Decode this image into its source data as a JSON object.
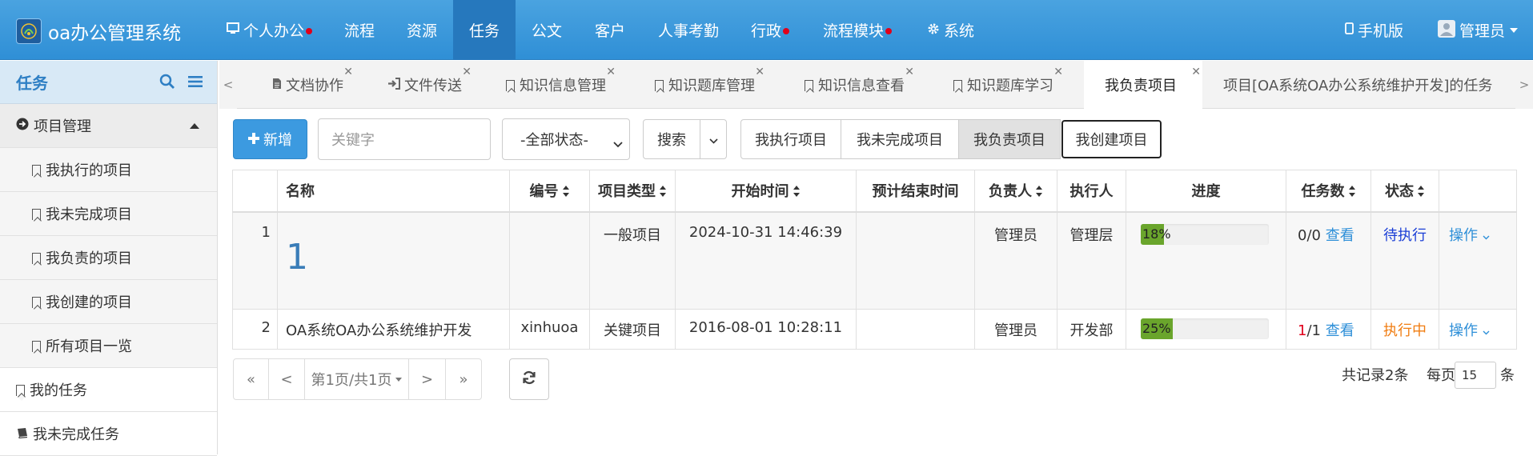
{
  "app": {
    "title": "oa办公管理系统"
  },
  "nav": {
    "items": [
      {
        "label": "个人办公",
        "icon": "monitor-icon",
        "dot": true
      },
      {
        "label": "流程"
      },
      {
        "label": "资源"
      },
      {
        "label": "任务",
        "active": true
      },
      {
        "label": "公文"
      },
      {
        "label": "客户"
      },
      {
        "label": "人事考勤"
      },
      {
        "label": "行政",
        "dot": true
      },
      {
        "label": "流程模块",
        "dot": true
      },
      {
        "label": "系统",
        "icon": "gear-icon"
      }
    ],
    "mobile_label": "手机版",
    "user_label": "管理员"
  },
  "sidebar": {
    "title": "任务",
    "group_label": "项目管理",
    "items": [
      {
        "label": "我执行的项目"
      },
      {
        "label": "我未完成项目"
      },
      {
        "label": "我负责的项目"
      },
      {
        "label": "我创建的项目"
      },
      {
        "label": "所有项目一览"
      }
    ],
    "my_tasks_label": "我的任务",
    "unfinished_tasks_label": "我未完成任务"
  },
  "tabs": {
    "prev_label": "<",
    "next_label": ">",
    "items": [
      {
        "label": "文档协作"
      },
      {
        "label": "文件传送"
      },
      {
        "label": "知识信息管理"
      },
      {
        "label": "知识题库管理"
      },
      {
        "label": "知识信息查看"
      },
      {
        "label": "知识题库学习"
      },
      {
        "label": "我负责项目",
        "active": true
      },
      {
        "label": "项目[OA系统OA办公系统维护开发]的任务"
      }
    ]
  },
  "toolbar": {
    "new_label": "新增",
    "keyword_placeholder": "关键字",
    "status_select": "-全部状态-",
    "search_label": "搜索",
    "filters": [
      "我执行项目",
      "我未完成项目",
      "我负责项目",
      "我创建项目"
    ]
  },
  "table": {
    "headers": [
      "名称",
      "编号",
      "项目类型",
      "开始时间",
      "预计结束时间",
      "负责人",
      "执行人",
      "进度",
      "任务数",
      "状态"
    ],
    "rows": [
      {
        "index": "1",
        "name": "1",
        "code": "",
        "type": "一般项目",
        "start": "2024-10-31 14:46:39",
        "end": "",
        "owner": "管理员",
        "executor": "管理层",
        "progress": 0.18,
        "progress_label": "18%",
        "done": "0",
        "total": "/0",
        "view": "查看",
        "status": "待执行",
        "action": "操作"
      },
      {
        "index": "2",
        "name": "OA系统OA办公系统维护开发",
        "code": "xinhuoa",
        "type": "关键项目",
        "start": "2016-08-01 10:28:11",
        "end": "",
        "owner": "管理员",
        "executor": "开发部",
        "progress": 0.25,
        "progress_label": "25%",
        "done": "1",
        "total": "/1",
        "view": "查看",
        "status": "执行中",
        "action": "操作"
      }
    ]
  },
  "pager": {
    "first": "«",
    "prev": "<",
    "page_label": "第1页/共1页",
    "next": ">",
    "last": "»",
    "total_label": "共记录2条",
    "per_page_label": "每页",
    "per_page_value": "15",
    "per_page_suffix": "条"
  },
  "colors": {
    "nav_bg": "#3d9ae0",
    "accent": "#2e8fd8",
    "progress_fill": "#6aa52c",
    "status_pending": "#1a3ed6",
    "status_running": "#f07d12",
    "done_red": "#e0001b"
  }
}
